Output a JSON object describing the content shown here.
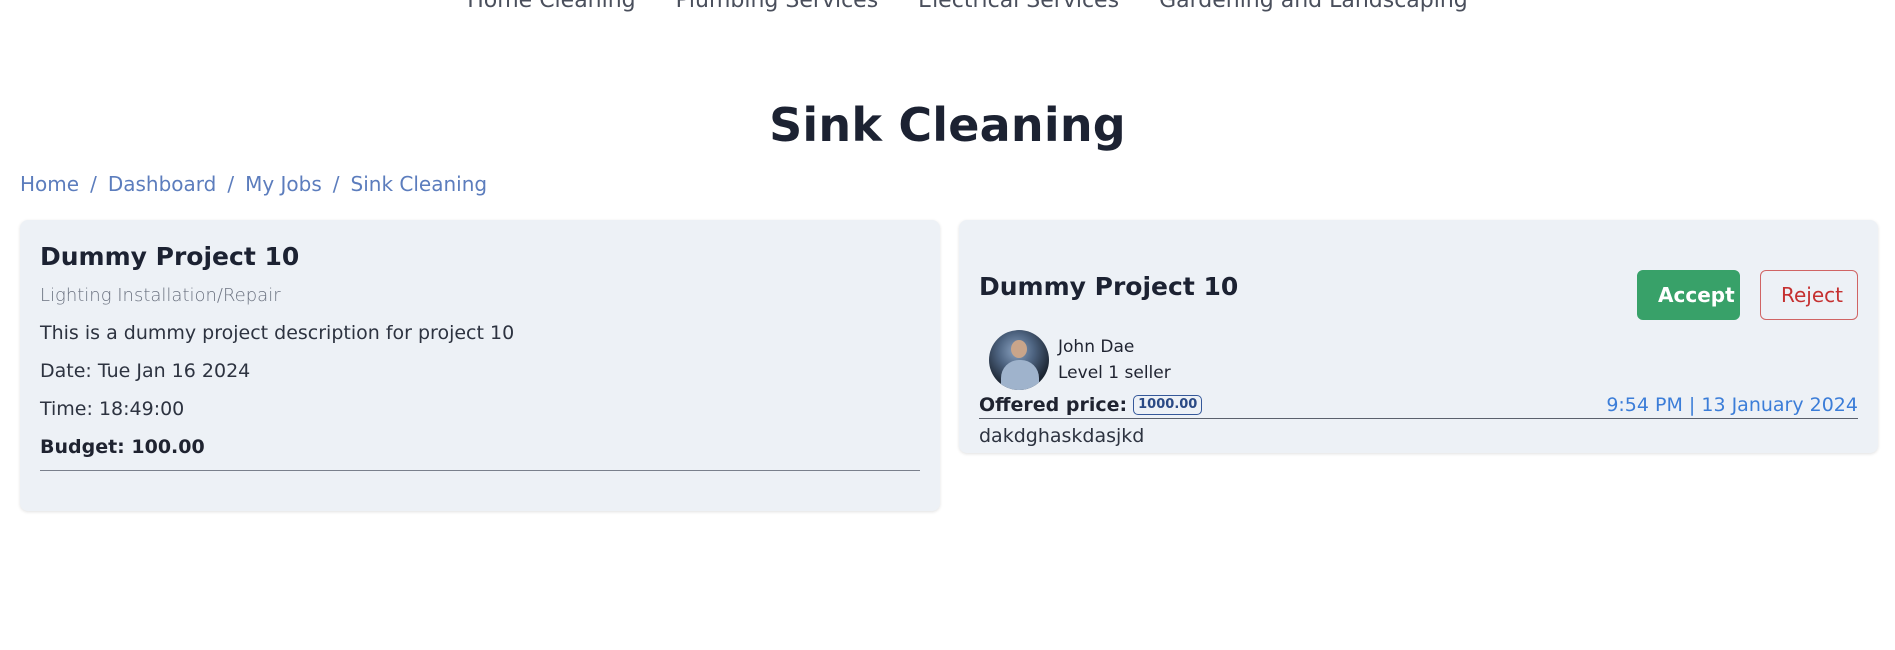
{
  "nav": {
    "items": [
      {
        "label": "Home Cleaning"
      },
      {
        "label": "Plumbing Services"
      },
      {
        "label": "Electrical Services"
      },
      {
        "label": "Gardening and Landscaping"
      }
    ]
  },
  "page": {
    "title": "Sink Cleaning"
  },
  "breadcrumb": {
    "items": [
      "Home",
      "Dashboard",
      "My Jobs",
      "Sink Cleaning"
    ],
    "separator": "/"
  },
  "project": {
    "title": "Dummy Project 10",
    "category": "Lighting Installation/Repair",
    "description": "This is a dummy project description for project 10",
    "date": "Date: Tue Jan 16 2024",
    "time": "Time: 18:49:00",
    "budget": "Budget: 100.00"
  },
  "offer": {
    "project_title": "Dummy Project 10",
    "accept_label": "Accept",
    "reject_label": "Reject",
    "seller_name": "John Dae",
    "seller_level": "Level 1 seller",
    "price_label": "Offered price:",
    "price_value": "1000.00",
    "timestamp": "9:54 PM | 13 January 2024",
    "message": "dakdghaskdasjkd"
  },
  "colors": {
    "accent_blue": "#3b7dd8",
    "accept_green": "#38a169",
    "reject_red": "#c53030",
    "card_bg": "#edf1f6"
  }
}
